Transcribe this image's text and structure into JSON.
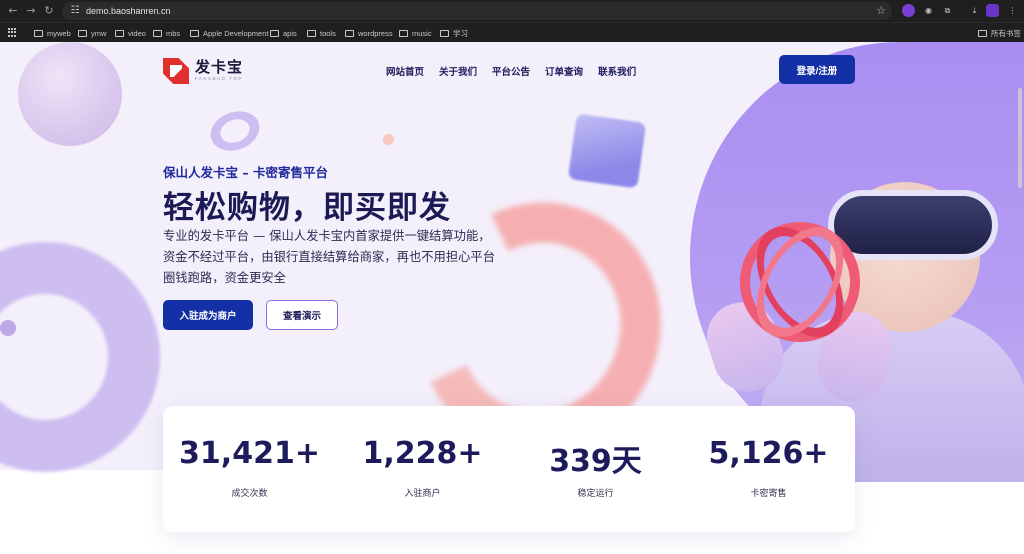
{
  "browser": {
    "url": "demo.baoshanren.cn",
    "bookmarks": [
      {
        "label": "myweb"
      },
      {
        "label": "ymw"
      },
      {
        "label": "video"
      },
      {
        "label": "mbs"
      },
      {
        "label": "Apple Development"
      },
      {
        "label": "apis"
      },
      {
        "label": "tools"
      },
      {
        "label": "wordpress"
      },
      {
        "label": "music"
      },
      {
        "label": "学习"
      }
    ],
    "all_bookmarks_label": "所有书签"
  },
  "header": {
    "logo_text": "发卡宝",
    "logo_sub": "FAKABAO.TOP",
    "nav": [
      {
        "label": "网站首页"
      },
      {
        "label": "关于我们"
      },
      {
        "label": "平台公告"
      },
      {
        "label": "订单查询"
      },
      {
        "label": "联系我们"
      }
    ],
    "login_label": "登录/注册"
  },
  "hero": {
    "kicker": "保山人发卡宝 – 卡密寄售平台",
    "title": "轻松购物，即买即发",
    "description": "专业的发卡平台 — 保山人发卡宝内首家提供一键结算功能， 资金不经过平台，由银行直接结算给商家，再也不用担心平台圈钱跑路，资金更安全",
    "primary_button": "入驻成为商户",
    "secondary_button": "查看演示"
  },
  "stats": [
    {
      "value": "31,421+",
      "label": "成交次数"
    },
    {
      "value": "1,228+",
      "label": "入驻商户"
    },
    {
      "value": "339天",
      "label": "稳定运行"
    },
    {
      "value": "5,126+",
      "label": "卡密寄售"
    }
  ],
  "colors": {
    "accent": "#1430a6",
    "title": "#1b1a55",
    "logo_red": "#e0302e",
    "hero_bg": "#f3effb",
    "purple": "#a98ef1"
  }
}
